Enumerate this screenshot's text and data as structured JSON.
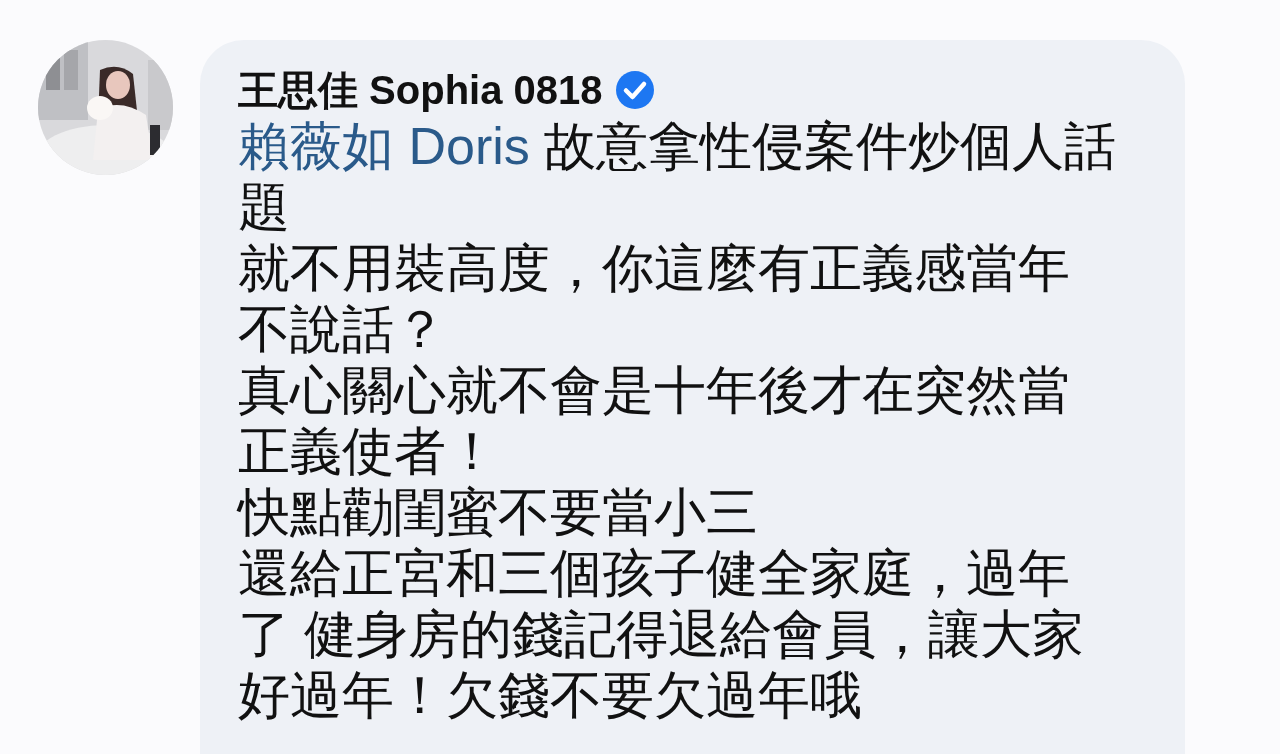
{
  "comment": {
    "author": {
      "name": "王思佳 Sophia 0818",
      "verified": true
    },
    "paragraphs": [
      {
        "mention": "賴薇如 Doris",
        "text": " 故意拿性侵案件炒個人話題"
      },
      {
        "text": "就不用裝高度，你這麼有正義感當年不說話？"
      },
      {
        "text": "真心關心就不會是十年後才在突然當正義使者！"
      },
      {
        "text": "快點勸閨蜜不要當小三"
      },
      {
        "text": "還給正宮和三個孩子健全家庭，過年了 健身房的錢記得退給會員，讓大家好過年！欠錢不要欠過年哦"
      }
    ]
  }
}
